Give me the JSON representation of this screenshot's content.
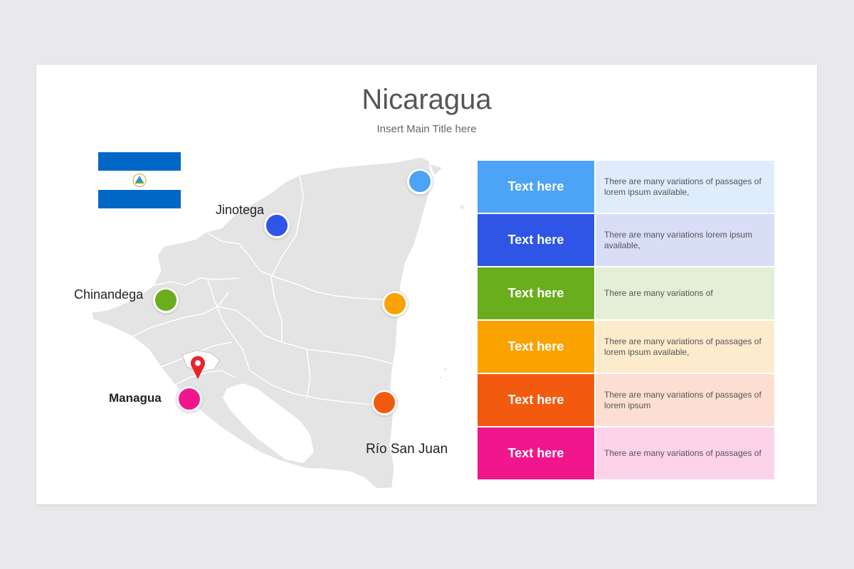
{
  "slide": {
    "title": "Nicaragua",
    "subtitle": "Insert Main Title here"
  },
  "map": {
    "fill_color": "#e4e4e4",
    "border_color": "#ffffff",
    "lake_color": "#ffffff",
    "pin_color": "#e8242b",
    "markers": [
      {
        "name": "north-coast",
        "color": "#4da3f5",
        "label": ""
      },
      {
        "name": "jinotega",
        "color": "#2f55e6",
        "label": "Jinotega"
      },
      {
        "name": "chinandega",
        "color": "#6aae1e",
        "label": "Chinandega"
      },
      {
        "name": "east-coast",
        "color": "#f9a200",
        "label": ""
      },
      {
        "name": "managua",
        "color": "#f2168d",
        "label": "Managua"
      },
      {
        "name": "rio-san-juan",
        "color": "#f25a0f",
        "label": "Río San Juan"
      }
    ]
  },
  "flag": {
    "stripe_color": "#0067c6",
    "center_color": "#ffffff",
    "emblem": "coat-of-arms"
  },
  "rows": [
    {
      "label": "Text here",
      "desc": "There are many variations of passages of lorem ipsum available,",
      "color": "#4da3f5",
      "bg": "#deecfc"
    },
    {
      "label": "Text here",
      "desc": "There are many variations lorem ipsum available,",
      "color": "#2f55e6",
      "bg": "#d9def7"
    },
    {
      "label": "Text here",
      "desc": "There are many variations of",
      "color": "#6aae1e",
      "bg": "#e3efd6"
    },
    {
      "label": "Text here",
      "desc": "There are many variations of passages of lorem ipsum available,",
      "color": "#f9a200",
      "bg": "#fcebcd"
    },
    {
      "label": "Text here",
      "desc": "There are many variations of passages of lorem ipsum",
      "color": "#f25a0f",
      "bg": "#fcdfd2"
    },
    {
      "label": "Text here",
      "desc": "There are many variations of passages of",
      "color": "#f2168d",
      "bg": "#fcd2e9"
    }
  ]
}
